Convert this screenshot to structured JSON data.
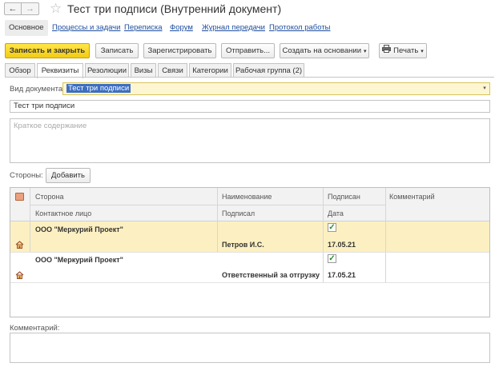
{
  "window": {
    "title": "Тест три подписи (Внутренний документ)",
    "back_glyph": "←",
    "forward_glyph": "→",
    "star_glyph": "☆"
  },
  "panel_nav": {
    "active": "Основное",
    "links": [
      "Процессы и задачи",
      "Переписка",
      "Форум",
      "Журнал передачи",
      "Протокол работы"
    ]
  },
  "toolbar": {
    "save_close": "Записать и закрыть",
    "save": "Записать",
    "register": "Зарегистрировать",
    "send": "Отправить...",
    "create_based": "Создать на основании",
    "print": "Печать",
    "caret": "▾"
  },
  "tabs": [
    "Обзор",
    "Реквизиты",
    "Резолюции",
    "Визы",
    "Связи",
    "Категории",
    "Рабочая группа (2)"
  ],
  "form": {
    "doc_type_label": "Вид документа:",
    "doc_type_value": "Тест три подписи",
    "title_value": "Тест три подписи",
    "summary_placeholder": "Краткое содержание",
    "parties_label": "Стороны:",
    "add_button": "Добавить",
    "comment_label": "Комментарий:"
  },
  "parties_table": {
    "header_row1": [
      "Сторона",
      "Наименование",
      "Подписан",
      "Комментарий"
    ],
    "header_row2": [
      "Контактное лицо",
      "Подписал",
      "Дата"
    ],
    "rows": [
      {
        "party": "ООО \"Меркурий Проект\"",
        "signer": "Петров И.С.",
        "signed": true,
        "date": "17.05.21",
        "selected": true
      },
      {
        "party": "ООО \"Меркурий Проект\"",
        "signer": "Ответственный за отгрузку",
        "signed": true,
        "date": "17.05.21",
        "selected": false
      }
    ],
    "check_glyph": "✓"
  },
  "colors": {
    "primary_button": "#f3cb12",
    "selected_row": "#fcf0c2",
    "link": "#1d4e9e"
  }
}
